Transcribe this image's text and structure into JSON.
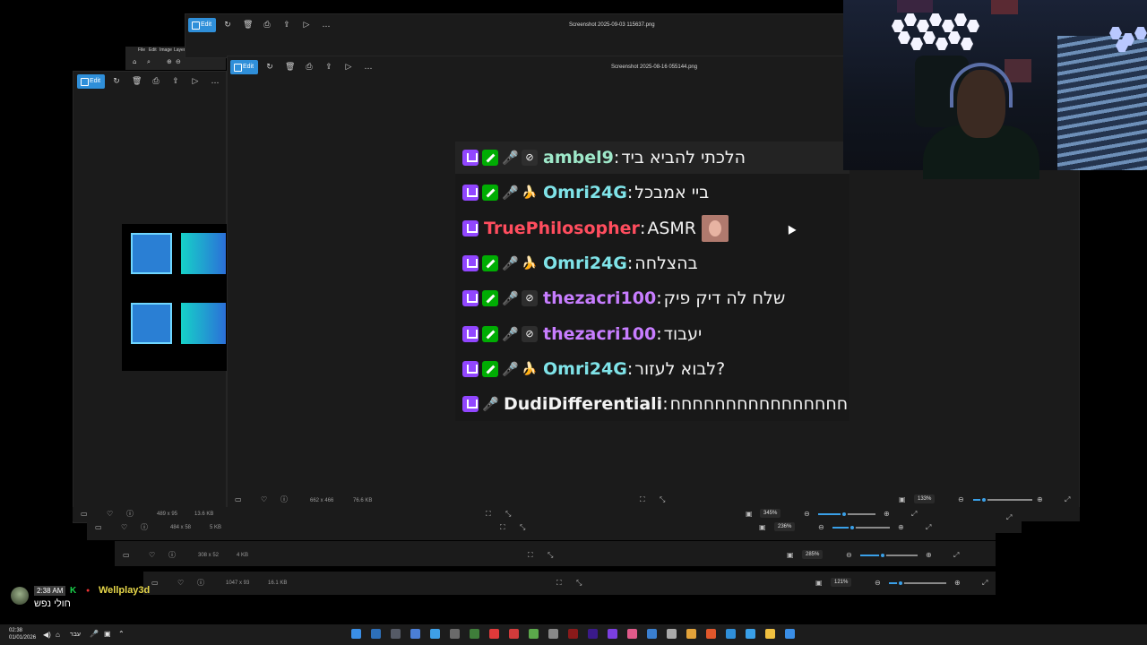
{
  "windows": {
    "back_left": {
      "edit_label": "Edit",
      "status_dims": "489 x 95",
      "status_size": "13.6 KB",
      "zoom": "345%"
    },
    "back_strip1": {
      "status_dims": "484 x 58",
      "status_size": "5 KB",
      "zoom": "236%"
    },
    "back_strip2": {
      "status_dims": "308 x 52",
      "status_size": "4 KB",
      "zoom": "285%"
    },
    "back_strip3": {
      "status_dims": "1047 x 93",
      "status_size": "16.1 KB",
      "zoom": "121%"
    },
    "top_window": {
      "edit_label": "Edit",
      "title": "Screenshot 2025-09-03 115637.png"
    },
    "main_window": {
      "edit_label": "Edit",
      "title": "Screenshot 2025-08-16 055144.png",
      "status_dims": "662 x 466",
      "status_size": "76.6 KB",
      "zoom": "133%"
    },
    "tiny_menu": [
      "File",
      "Edit",
      "Image",
      "Layer"
    ]
  },
  "chat": [
    {
      "user": "ambel9",
      "color": "#9ee8c9",
      "badges": [
        "twitch",
        "mod",
        "mic",
        "hide"
      ],
      "message": "הלכתי להביא ביד"
    },
    {
      "user": "Omri24G",
      "color": "#7fe3e8",
      "badges": [
        "twitch",
        "mod",
        "mic",
        "banana"
      ],
      "message": "ביי אמבכל"
    },
    {
      "user": "TruePhilosopher",
      "color": "#ff4d5e",
      "badges": [
        "twitch"
      ],
      "message": "ASMR",
      "emote": true
    },
    {
      "user": "Omri24G",
      "color": "#7fe3e8",
      "badges": [
        "twitch",
        "mod",
        "mic",
        "banana"
      ],
      "message": "בהצלחה"
    },
    {
      "user": "thezacri100",
      "color": "#c77dff",
      "badges": [
        "twitch",
        "mod",
        "mic",
        "hide"
      ],
      "message": "שלח לה דיק פיק"
    },
    {
      "user": "thezacri100",
      "color": "#c77dff",
      "badges": [
        "twitch",
        "mod",
        "mic",
        "hide"
      ],
      "message": "יעבוד"
    },
    {
      "user": "Omri24G",
      "color": "#7fe3e8",
      "badges": [
        "twitch",
        "mod",
        "mic",
        "banana"
      ],
      "message": "לבוא לעזור?"
    },
    {
      "user": "DudiDifferentiali",
      "color": "#f2f2f2",
      "badges": [
        "twitch",
        "mic"
      ],
      "message": "חחחחחחחחחחחחחחחח"
    }
  ],
  "overlay_chat": {
    "time": "2:38 AM",
    "user": "Wellplay3d",
    "message": "חולי נפש"
  },
  "taskbar": {
    "time": "02:38",
    "date": "01/01/2026",
    "lang": "עבר"
  },
  "colors": {
    "accent": "#2f8fd9",
    "window_bg": "#1b1b1b",
    "chat_bg": "#181818"
  }
}
